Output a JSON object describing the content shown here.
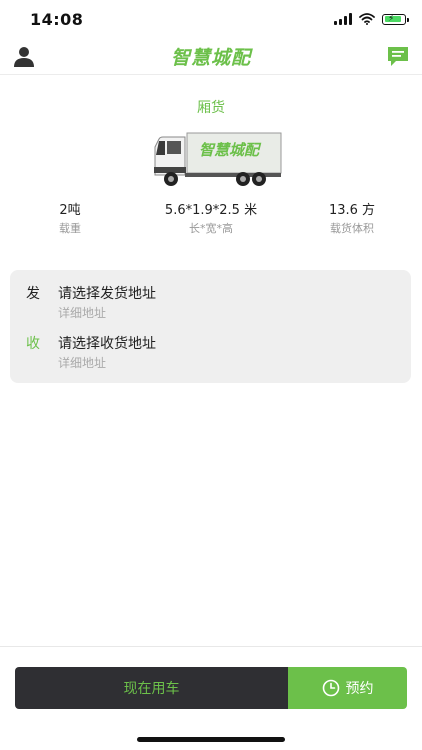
{
  "status_bar": {
    "time": "14:08",
    "battery_charging": true
  },
  "header": {
    "brand": "智慧城配",
    "brand_color": "#6cc04a",
    "left_icon": "user-icon",
    "right_icon": "message-icon"
  },
  "vehicle": {
    "type": "厢货",
    "image_icon": "box-truck-icon",
    "truck_label": "智慧城配",
    "specs": [
      {
        "value": "2吨",
        "label": "载重"
      },
      {
        "value": "5.6*1.9*2.5 米",
        "label": "长*宽*高"
      },
      {
        "value": "13.6 方",
        "label": "载货体积"
      }
    ]
  },
  "addresses": {
    "from": {
      "prefix": "发",
      "title": "请选择发货地址",
      "detail": "详细地址"
    },
    "to": {
      "prefix": "收",
      "title": "请选择收货地址",
      "detail": "详细地址",
      "prefix_color": "#6cc04a"
    }
  },
  "actions": {
    "now": "现在用车",
    "reserve": "预约",
    "reserve_icon": "clock-icon"
  },
  "colors": {
    "accent": "#6cc04a",
    "dark": "#2f2f33",
    "card": "#efefef"
  }
}
